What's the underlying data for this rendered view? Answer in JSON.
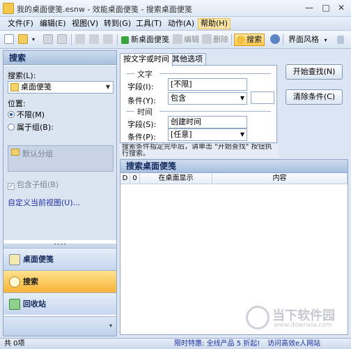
{
  "window": {
    "title": "我的桌面便笺.esnw - 效能桌面便笺 - 搜索桌面便笺",
    "min_label": "—",
    "max_label": "□",
    "close_label": "✕"
  },
  "menu": {
    "items": [
      "文件(F)",
      "编辑(E)",
      "视图(V)",
      "转到(G)",
      "工具(T)",
      "动作(A)",
      "帮助(H)"
    ]
  },
  "toolbar": {
    "new_note": "新桌面便笺",
    "edit": "编辑",
    "delete": "删除",
    "search": "搜索",
    "theme": "界面风格",
    "theme_arrow": "▾",
    "dropdown_arrow": "▾"
  },
  "left": {
    "header": "搜索",
    "search_label": "搜索(L):",
    "search_value": "桌面便笺",
    "position_label": "位置:",
    "radio_unlimited": "不限(M)",
    "radio_group": "属于组(B):",
    "group_default": "默认分组",
    "include_subgroups": "包含子组(B)",
    "custom_view": "自定义当前视图(U)...",
    "grip": "••••",
    "nav": [
      "桌面便笺",
      "搜索",
      "回收站"
    ],
    "nav_more": "▾"
  },
  "conditions": {
    "tabs": [
      "按文字或时间",
      "其他选项"
    ],
    "text_section": "文字",
    "field_label_text": "字段(I):",
    "field_value_text": "[不限]",
    "cond_label_text": "条件(Y):",
    "cond_value_text": "包含",
    "time_section": "时间",
    "field_label_time": "字段(S):",
    "field_value_time": "创建时间",
    "cond_label_time": "条件(P):",
    "cond_value_time": "[任意]",
    "hint": "搜索条件指定完毕后，请单击 \"开始查找\" 按钮执行搜索。",
    "start_button": "开始查找(N)",
    "clear_button": "清除条件(C)"
  },
  "results": {
    "header": "搜索桌面便笺",
    "columns": [
      "D",
      "0",
      "在桌面显示",
      "内容"
    ]
  },
  "watermark": {
    "cn": "当下软件园",
    "en": "www.downxia.com"
  },
  "status": {
    "count": "共 0项",
    "promo_prefix": "限时特惠:",
    "promo_text": "全线产品 5 折起!",
    "visit": "访问高效e人网站"
  },
  "colors": {
    "accent_orange": "#f7b437",
    "window_bg": "#dce6f4",
    "link_blue": "#1b2fa8"
  }
}
